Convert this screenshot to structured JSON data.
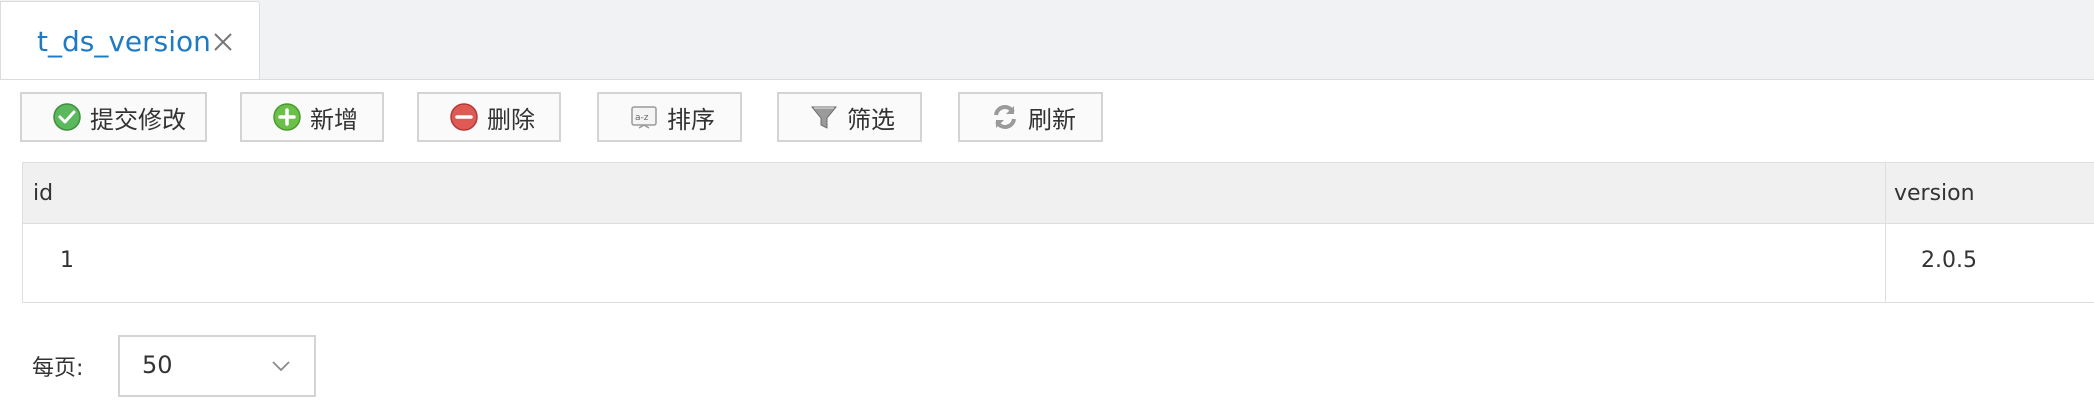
{
  "tabs": [
    {
      "label": "t_ds_version",
      "active": true
    }
  ],
  "toolbar": {
    "buttons": [
      {
        "label": "提交修改",
        "icon": "check-circle-icon"
      },
      {
        "label": "新增",
        "icon": "plus-circle-icon"
      },
      {
        "label": "删除",
        "icon": "minus-circle-icon"
      },
      {
        "label": "排序",
        "icon": "sort-az-icon"
      },
      {
        "label": "筛选",
        "icon": "filter-funnel-icon"
      },
      {
        "label": "刷新",
        "icon": "refresh-icon"
      }
    ]
  },
  "table": {
    "columns": [
      "id",
      "version"
    ],
    "rows": [
      [
        "1",
        "2.0.5"
      ]
    ]
  },
  "pager": {
    "label": "每页:",
    "page_size": "50"
  },
  "colors": {
    "accent": "#1f7ac4",
    "check_green": "#5cb85c",
    "plus_green": "#6cc04a",
    "minus_red": "#e05a55",
    "header_bg": "#f0f0f0",
    "border": "#dedede"
  }
}
